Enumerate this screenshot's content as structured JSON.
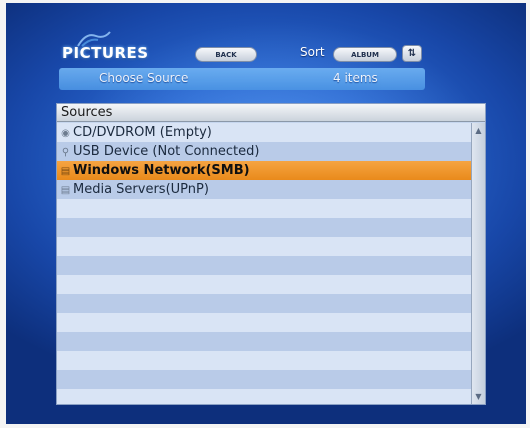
{
  "header": {
    "title": "PICTURES",
    "back_label": "BACK",
    "sort_label": "Sort",
    "sort_value": "ALBUM",
    "sort_direction_glyph": "⇅"
  },
  "source_bar": {
    "label": "Choose Source",
    "count": "4 items"
  },
  "panel": {
    "header": "Sources",
    "items": [
      {
        "label": "CD/DVDROM (Empty)",
        "icon": "disc-icon",
        "glyph": "◉",
        "selected": false
      },
      {
        "label": "USB Device (Not Connected)",
        "icon": "usb-icon",
        "glyph": "⚲",
        "selected": false
      },
      {
        "label": "Windows Network(SMB)",
        "icon": "network-icon",
        "glyph": "▤",
        "selected": true
      },
      {
        "label": "Media Servers(UPnP)",
        "icon": "media-server-icon",
        "glyph": "▤",
        "selected": false
      }
    ],
    "empty_rows": 11
  },
  "colors": {
    "background": "#2a68d0",
    "selection": "#f09530",
    "row_light": "#d9e4f5",
    "row_dark": "#b9cbe8"
  }
}
